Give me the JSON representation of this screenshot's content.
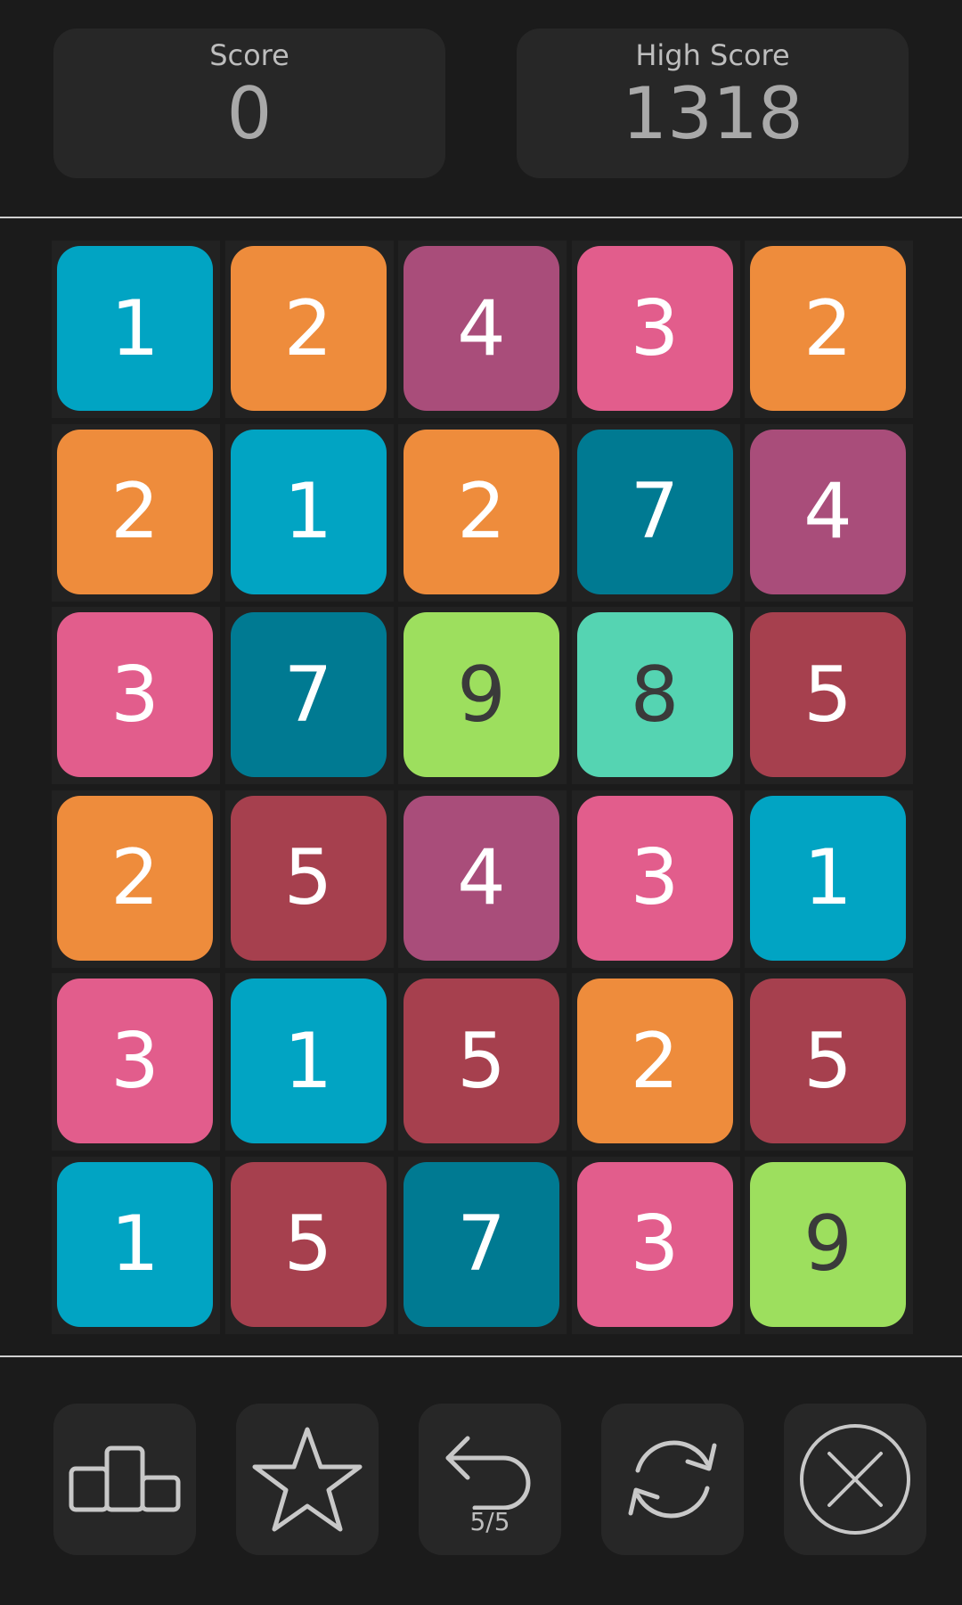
{
  "score": {
    "label": "Score",
    "value": "0"
  },
  "high_score": {
    "label": "High Score",
    "value": "1318"
  },
  "tile_colors": {
    "1": "#01a4c3",
    "2": "#ee8c3c",
    "3": "#e25d8c",
    "4": "#a94d7a",
    "5": "#a6404e",
    "7": "#007a92",
    "8": "#55d4b2",
    "9": "#9ddf5e"
  },
  "dark_text_values": [
    "8",
    "9"
  ],
  "board": {
    "rows": [
      [
        "1",
        "2",
        "4",
        "3",
        "2"
      ],
      [
        "2",
        "1",
        "2",
        "7",
        "4"
      ],
      [
        "3",
        "7",
        "9",
        "8",
        "5"
      ],
      [
        "2",
        "5",
        "4",
        "3",
        "1"
      ],
      [
        "3",
        "1",
        "5",
        "2",
        "5"
      ],
      [
        "1",
        "5",
        "7",
        "3",
        "9"
      ]
    ]
  },
  "toolbar": {
    "buttons": [
      {
        "name": "leaderboard",
        "icon": "podium-icon"
      },
      {
        "name": "favorite",
        "icon": "star-icon"
      },
      {
        "name": "undo",
        "icon": "undo-arrow-icon",
        "count": "5/5"
      },
      {
        "name": "restart",
        "icon": "refresh-icon"
      },
      {
        "name": "close",
        "icon": "close-circle-icon"
      }
    ]
  }
}
